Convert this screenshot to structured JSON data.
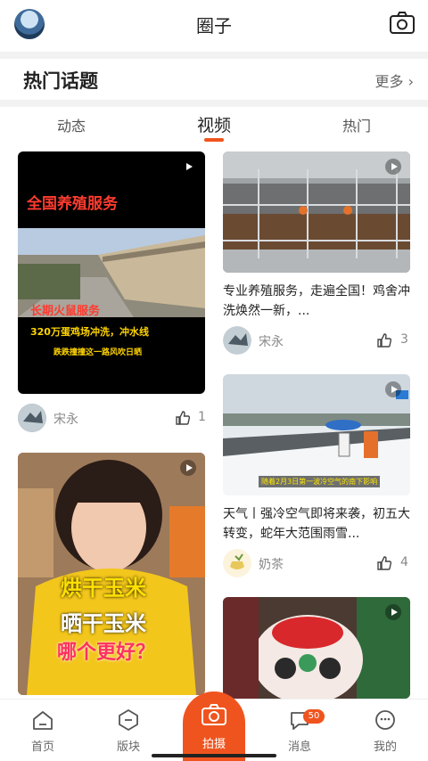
{
  "header": {
    "title": "圈子"
  },
  "topics": {
    "title": "热门话题",
    "more_label": "更多"
  },
  "tabs": [
    {
      "label": "动态",
      "active": false
    },
    {
      "label": "视频",
      "active": true
    },
    {
      "label": "热门",
      "active": false
    }
  ],
  "cards": [
    {
      "overlay_lines": [
        "全国养殖服务",
        "长期火鼠服务",
        "320万蛋鸡场冲洗，冲水线",
        "跌跌撞撞这一路风吹日晒"
      ],
      "author": "宋永",
      "likes": "1"
    },
    {
      "desc": "专业养殖服务，走遍全国！鸡舍冲洗焕然一新，...",
      "author": "宋永",
      "likes": "3"
    },
    {
      "caption": "随着2月3日第一波冷空气的南下影响",
      "desc": "天气丨强冷空气即将来袭，初五大转变，蛇年大范围雨雪...",
      "author": "奶茶",
      "likes": "4"
    },
    {
      "overlay_lines": [
        "烘干玉米",
        "晒干玉米",
        "哪个更好？"
      ]
    },
    {}
  ],
  "bottom_nav": {
    "home": "首页",
    "blocks": "版块",
    "shoot": "拍摄",
    "messages": "消息",
    "messages_badge": "50",
    "mine": "我的"
  },
  "colors": {
    "accent": "#f0541e"
  }
}
